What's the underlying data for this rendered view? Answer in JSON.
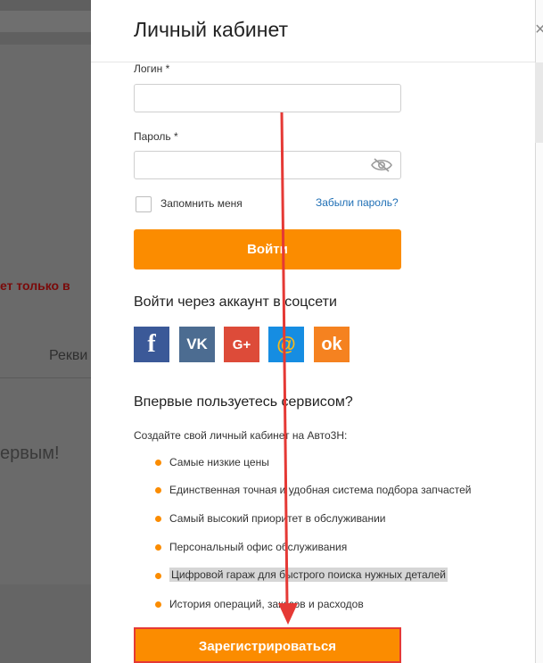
{
  "background": {
    "alert_text": "ет только в",
    "requisites_text": "Рекви",
    "first_text": "ервым!"
  },
  "modal": {
    "title": "Личный кабинет",
    "close_icon": "×",
    "login_label": "Логин *",
    "login_value": "",
    "password_label": "Пароль *",
    "password_value": "",
    "remember_label": "Запомнить меня",
    "forgot_link": "Забыли пароль?",
    "login_button": "Войти",
    "social_title": "Войти через аккаунт в соцсети",
    "social": [
      {
        "name": "facebook",
        "glyph": "f",
        "color": "#3b5998"
      },
      {
        "name": "vkontakte",
        "glyph": "VK",
        "color": "#4c6c91"
      },
      {
        "name": "google-plus",
        "glyph": "G+",
        "color": "#dd4b39"
      },
      {
        "name": "mail-ru",
        "glyph": "@",
        "color": "#168de2"
      },
      {
        "name": "odnoklassniki",
        "glyph": "ok",
        "color": "#f58220"
      }
    ],
    "new_user_title": "Впервые пользуетесь сервисом?",
    "create_text": "Создайте свой личный кабинет на Авто3Н:",
    "features": [
      "Самые низкие цены",
      "Единственная точная и удобная система подбора запчастей",
      "Самый высокий приоритет в обслуживании",
      "Персональный офис обслуживания",
      "Цифровой гараж для быстрого поиска нужных деталей",
      "История операций, заказов и расходов"
    ],
    "register_button": "Зарегистрироваться"
  },
  "colors": {
    "accent": "#fb8c00",
    "link": "#1f6fb5",
    "annotation": "#e53935"
  }
}
